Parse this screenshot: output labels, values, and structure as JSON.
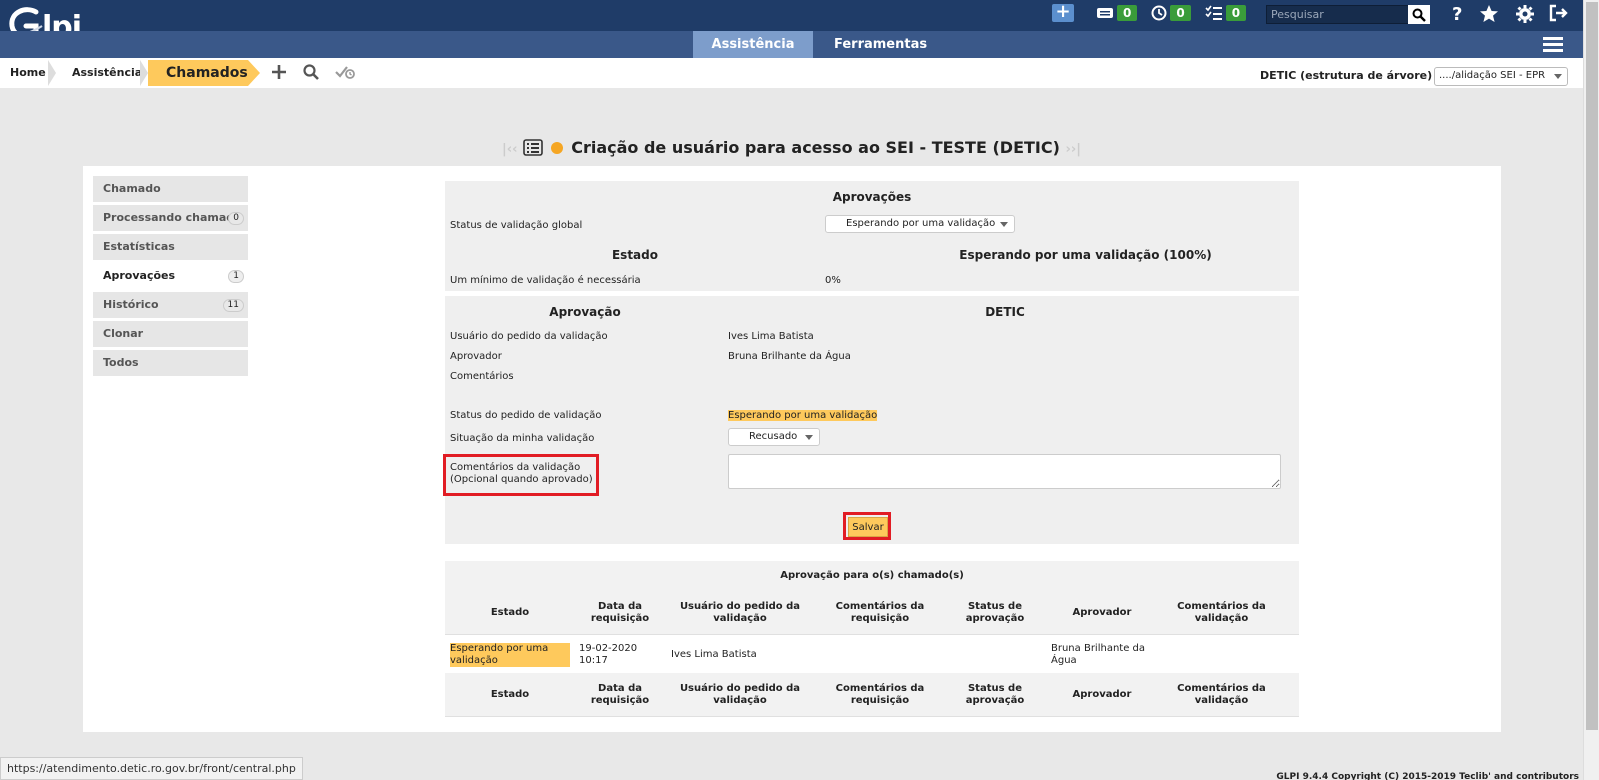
{
  "app": {
    "logo_text": "lpi"
  },
  "topbar": {
    "counters": [
      {
        "icon": "ticket-icon",
        "value": "0"
      },
      {
        "icon": "clock-icon",
        "value": "0"
      },
      {
        "icon": "checklist-icon",
        "value": "0"
      }
    ],
    "search_placeholder": "Pesquisar"
  },
  "menu": {
    "tabs": [
      "Assistência",
      "Ferramentas"
    ],
    "active": "Assistência"
  },
  "breadcrumb": {
    "home": "Home",
    "section": "Assistência",
    "current": "Chamados"
  },
  "entity": {
    "label": "DETIC (estrutura de árvore)",
    "selected": "..../alidação SEI - EPR"
  },
  "page": {
    "title": "Criação de usuário para acesso ao SEI - TESTE (DETIC)"
  },
  "sidebar": {
    "items": [
      {
        "label": "Chamado",
        "count": ""
      },
      {
        "label": "Processando chamado",
        "count": "0"
      },
      {
        "label": "Estatísticas",
        "count": ""
      },
      {
        "label": "Aprovações",
        "count": "1"
      },
      {
        "label": "Histórico",
        "count": "11"
      },
      {
        "label": "Clonar",
        "count": ""
      },
      {
        "label": "Todos",
        "count": ""
      }
    ]
  },
  "approvals": {
    "header": "Aprovações",
    "global_status_label": "Status de validação global",
    "global_status_value": "Esperando por uma validação",
    "state_header": "Estado",
    "state_value_header": "Esperando por uma validação (100%)",
    "min_label": "Um mínimo de validação é necessária",
    "min_value": "0%"
  },
  "approval": {
    "header_left": "Aprovação",
    "header_right": "DETIC",
    "requester_label": "Usuário do pedido da validação",
    "requester_value": "Ives Lima Batista",
    "approver_label": "Aprovador",
    "approver_value": "Bruna Brilhante da Água",
    "comments_label": "Comentários",
    "status_label": "Status do pedido de validação",
    "status_value": "Esperando por uma validação",
    "my_status_label": "Situação da minha validação",
    "my_status_value": "Recusado",
    "validation_comments_label_1": "Comentários da validação",
    "validation_comments_label_2": "(Opcional quando aprovado)",
    "save_label": "Salvar"
  },
  "table": {
    "title": "Aprovação para o(s) chamado(s)",
    "headers": [
      "Estado",
      "Data da requisição",
      "Usuário do pedido da validação",
      "Comentários da requisição",
      "Status de aprovação",
      "Aprovador",
      "Comentários da validação"
    ],
    "row": {
      "estado": "Esperando por uma validação",
      "data": "19-02-2020 10:17",
      "usuario": "Ives Lima Batista",
      "comentarios_req": "",
      "status": "",
      "aprovador": "Bruna Brilhante da Água",
      "comentarios_val": ""
    }
  },
  "statusbar": {
    "url": "https://atendimento.detic.ro.gov.br/front/central.php"
  },
  "footer": {
    "copyright": "GLPI 9.4.4 Copyright (C) 2015-2019 Teclib' and contributors"
  }
}
